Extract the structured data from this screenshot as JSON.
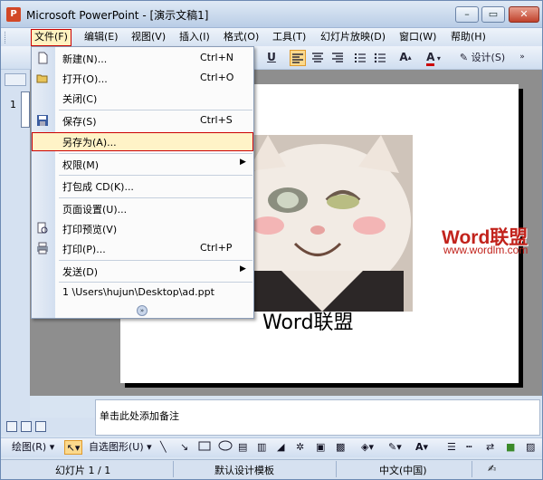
{
  "window": {
    "title": "Microsoft PowerPoint - [演示文稿1]",
    "app_icon": "P",
    "minimize": "–",
    "restore": "▭",
    "close": "✕"
  },
  "menubar": [
    {
      "label": "文件(F)",
      "active": true
    },
    {
      "label": "编辑(E)"
    },
    {
      "label": "视图(V)"
    },
    {
      "label": "插入(I)"
    },
    {
      "label": "格式(O)"
    },
    {
      "label": "工具(T)"
    },
    {
      "label": "幻灯片放映(D)"
    },
    {
      "label": "窗口(W)"
    },
    {
      "label": "帮助(H)"
    }
  ],
  "toolbar": {
    "underline": "U",
    "design_label": "设计(S)"
  },
  "file_menu": {
    "items": [
      {
        "label": "新建(N)...",
        "shortcut": "Ctrl+N",
        "icon": "new-document-icon"
      },
      {
        "label": "打开(O)...",
        "shortcut": "Ctrl+O",
        "icon": "open-folder-icon"
      },
      {
        "label": "关闭(C)"
      },
      {
        "label": "保存(S)",
        "shortcut": "Ctrl+S",
        "icon": "save-disk-icon"
      },
      {
        "label": "另存为(A)...",
        "highlighted": true
      },
      {
        "label": "权限(M)",
        "submenu": true
      },
      {
        "label": "打包成 CD(K)..."
      },
      {
        "label": "页面设置(U)..."
      },
      {
        "label": "打印预览(V)",
        "icon": "print-preview-icon"
      },
      {
        "label": "打印(P)...",
        "shortcut": "Ctrl+P",
        "icon": "printer-icon"
      },
      {
        "label": "发送(D)",
        "submenu": true
      },
      {
        "label": "1 \\Users\\hujun\\Desktop\\ad.ppt"
      }
    ],
    "expand": "»"
  },
  "slide": {
    "number": "1",
    "text": "Word联盟",
    "watermark_title": "Word联盟",
    "watermark_url": "www.wordlm.com"
  },
  "notes": {
    "placeholder": "单击此处添加备注"
  },
  "drawbar": {
    "draw_label": "绘图(R)",
    "autoshapes_label": "自选图形(U)"
  },
  "statusbar": {
    "slide": "幻灯片 1 / 1",
    "template": "默认设计模板",
    "language": "中文(中国)"
  },
  "colors": {
    "accent": "#c00000",
    "highlight": "#fff3c7",
    "title_bg": "#c9d8ec"
  }
}
